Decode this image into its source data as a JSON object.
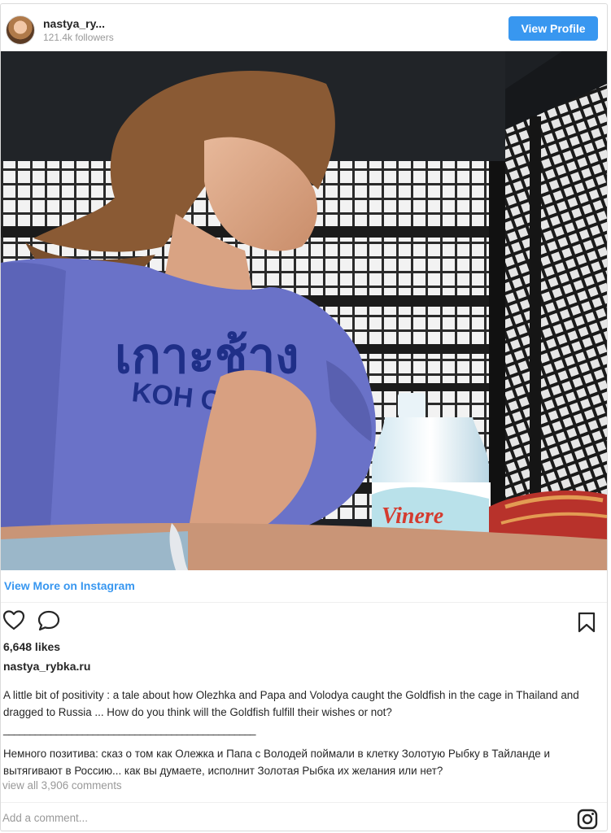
{
  "header": {
    "username": "nastya_ry...",
    "followers": "121.4k followers",
    "view_profile_label": "View Profile"
  },
  "photo": {
    "shirt_thai_text": "เกาะช้าง",
    "shirt_text": "KOH CHANG",
    "bottle_label": "Vinere"
  },
  "link": {
    "view_more": "View More on Instagram"
  },
  "actions": {
    "like_icon": "heart-outline-icon",
    "comment_icon": "speech-bubble-icon",
    "save_icon": "bookmark-icon"
  },
  "likes": "6,648 likes",
  "owner": "nastya_rybka.ru",
  "caption": {
    "en": "A little bit of positivity : a tale about how Olezhka and Papa and Volodya caught the Goldfish in the cage in Thailand and dragged to Russia ... How do you think will the Goldfish fulfill their wishes or not?",
    "rule": "________________________________________________",
    "ru": "Немного позитива: сказ о том как Олежка и Папа с Володей поймали в клетку Золотую Рыбку в Тайланде и вытягивают в Россию... как вы думаете, исполнит Золотая Рыбка их желания или нет?"
  },
  "comments": "view all 3,906 comments",
  "add_comment_placeholder": "Add a comment...",
  "footer_icon": "instagram-icon",
  "colors": {
    "accent": "#3897f0",
    "muted": "#999999",
    "border": "#dbdbdb"
  }
}
